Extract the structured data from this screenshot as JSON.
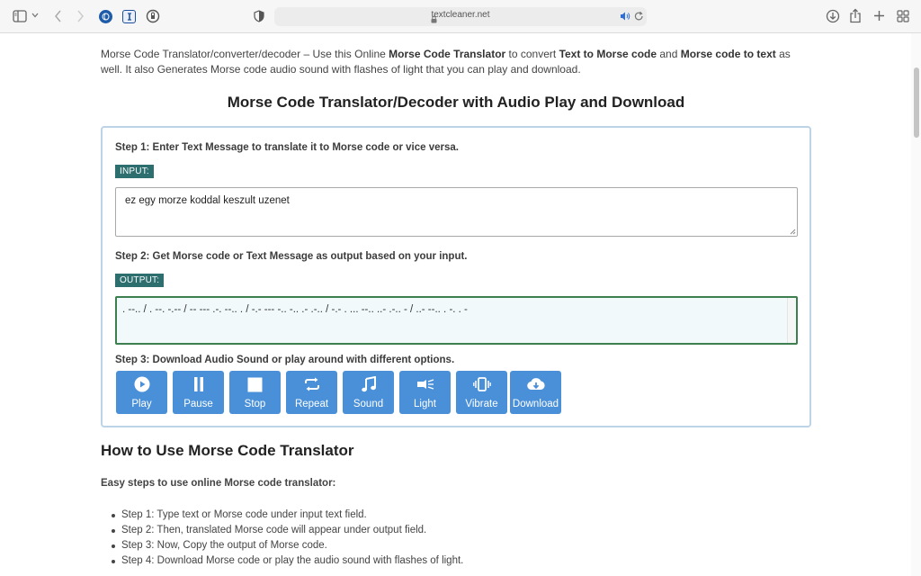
{
  "browser": {
    "url": "textcleaner.net"
  },
  "intro": {
    "t1": "Morse Code Translator/converter/decoder – Use this Online ",
    "b1": "Morse Code Translator",
    "t2": " to convert ",
    "b2": "Text to Morse code",
    "t3": " and ",
    "b3": "Morse code to text",
    "t4": " as well. It also Generates Morse code audio sound with flashes of light that you can play and download."
  },
  "page_title": "Morse Code Translator/Decoder with Audio Play and Download",
  "translator": {
    "step1": "Step 1: Enter Text Message to translate it to Morse code or vice versa.",
    "input_tag": "INPUT:",
    "input_value": "ez egy morze koddal keszult uzenet",
    "step2": "Step 2: Get Morse code or Text Message as output based on your input.",
    "output_tag": "OUTPUT:",
    "output_value": ". --.. / . --. -.-- / -- --- .-. --.. . / -.- --- -.. -.. .- .-.. / -.- . ... --.. ..- .-.. - / ..- --.. . -. . -",
    "step3": "Step 3: Download Audio Sound or play around with different options.",
    "buttons": [
      {
        "label": "Play",
        "icon": "play-circle-icon"
      },
      {
        "label": "Pause",
        "icon": "pause-icon"
      },
      {
        "label": "Stop",
        "icon": "stop-icon"
      },
      {
        "label": "Repeat",
        "icon": "repeat-icon"
      },
      {
        "label": "Sound",
        "icon": "music-note-icon"
      },
      {
        "label": "Light",
        "icon": "light-beam-icon"
      },
      {
        "label": "Vibrate",
        "icon": "vibrate-icon"
      },
      {
        "label": "Download",
        "icon": "cloud-download-icon"
      }
    ]
  },
  "howto": {
    "title": "How to Use Morse Code Translator",
    "subtitle": "Easy steps to use online Morse code translator:",
    "steps": [
      "Step 1: Type text or Morse code under input text field.",
      "Step 2: Then, translated Morse code will appear under output field.",
      "Step 3: Now, Copy the output of Morse code.",
      "Step 4: Download Morse code or play the audio sound with flashes of light."
    ]
  },
  "colors": {
    "button_blue": "#4a90d9",
    "tag_teal": "#2d6f6f",
    "output_border": "#3d7f4f",
    "panel_border": "#bdd3e8"
  }
}
